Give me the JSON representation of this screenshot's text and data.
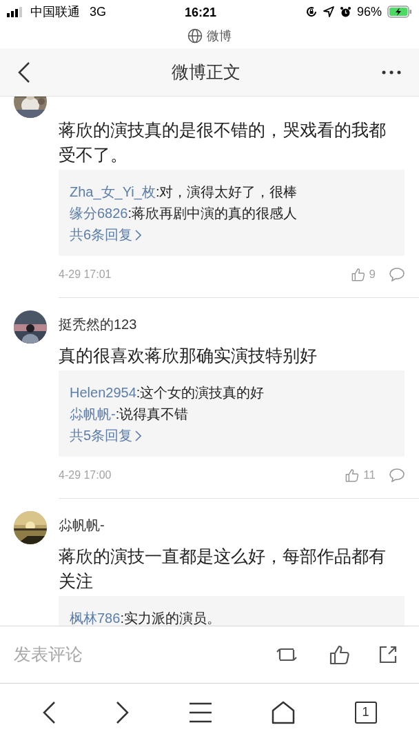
{
  "status_bar": {
    "carrier": "中国联通",
    "network": "3G",
    "time": "16:21",
    "battery": "96%"
  },
  "address_bar": {
    "site": "微博"
  },
  "nav": {
    "title": "微博正文"
  },
  "comments": [
    {
      "text": "蒋欣的演技真的是很不错的，哭戏看的我都受不了。",
      "replies": [
        {
          "user": "Zha_女_Yi_枚",
          "text": ":对，演得太好了，很棒"
        },
        {
          "user": "缘分6826",
          "text": ":蒋欣再剧中演的真的很感人"
        }
      ],
      "more": "共6条回复",
      "time": "4-29 17:01",
      "likes": "9"
    },
    {
      "name": "挺秃然的123",
      "text": "真的很喜欢蒋欣那确实演技特别好",
      "replies": [
        {
          "user": "Helen2954",
          "text": ":这个女的演技真的好"
        },
        {
          "user": "尛帆帆-",
          "text": ":说得真不错"
        }
      ],
      "more": "共5条回复",
      "time": "4-29 17:00",
      "likes": "11"
    },
    {
      "name": "尛帆帆-",
      "text": "蒋欣的演技一直都是这么好，每部作品都有关注",
      "replies": [
        {
          "user": "枫林786",
          "text": ":实力派的演员。"
        }
      ]
    }
  ],
  "composer": {
    "placeholder": "发表评论"
  },
  "toolbar": {
    "tabs": "1"
  }
}
